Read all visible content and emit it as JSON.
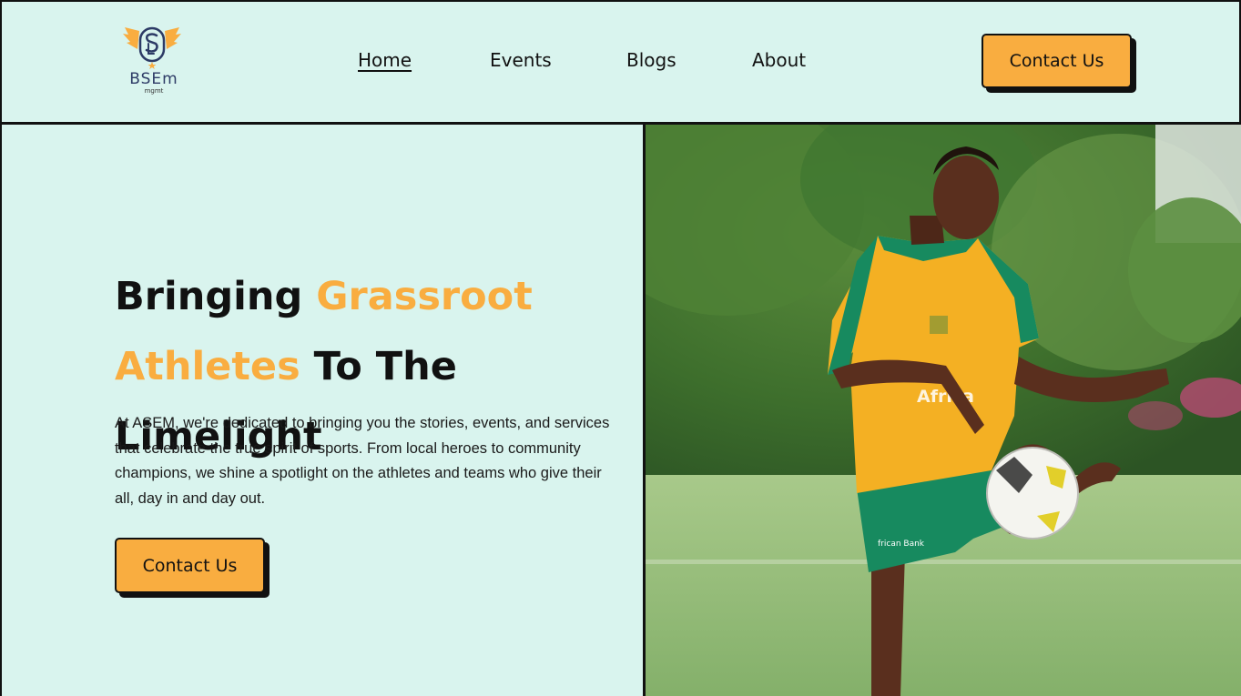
{
  "brand": {
    "logo_text": "BSEm",
    "logo_subtext": "mgmt"
  },
  "nav": {
    "items": [
      {
        "label": "Home",
        "active": true
      },
      {
        "label": "Events",
        "active": false
      },
      {
        "label": "Blogs",
        "active": false
      },
      {
        "label": "About",
        "active": false
      }
    ],
    "cta_label": "Contact Us"
  },
  "hero": {
    "headline": {
      "part1": "Bringing ",
      "part2_accent": "Grassroot",
      "part3_accent": "Athletes",
      "part4": " To The Limelight"
    },
    "paragraph": "At ASEM, we're dedicated to bringing you the stories, events, and services that celebrate the true spirit of sports. From local heroes to community champions, we shine a spotlight on the athletes and teams who give their all, day in and day out.",
    "cta_label": "Contact Us",
    "image_alt": "Young athlete in yellow and green kit juggling a football on a grass field",
    "jersey_text": "Africa",
    "shorts_text": "frican Bank"
  },
  "colors": {
    "background": "#d9f4ee",
    "accent": "#f9ad40",
    "border": "#111111",
    "logo_navy": "#2d3b66"
  }
}
